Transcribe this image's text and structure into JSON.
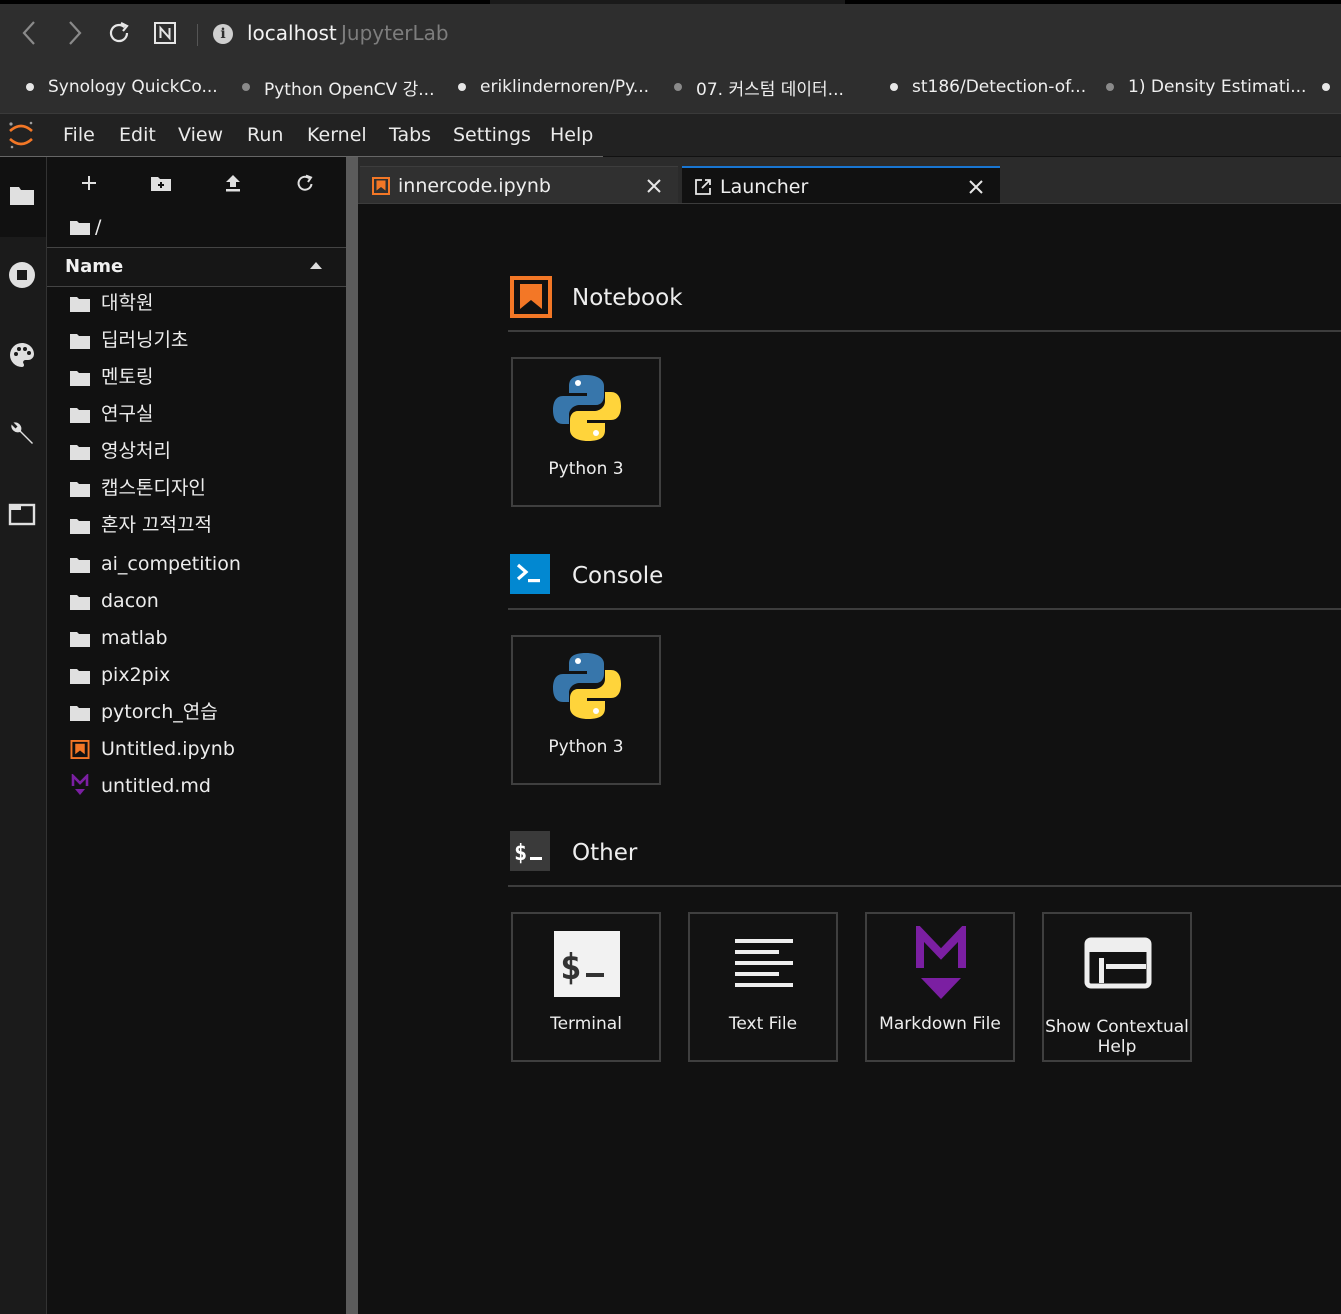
{
  "browser": {
    "url_host": "localhost",
    "page_title": "JupyterLab",
    "bookmarks": [
      {
        "label": "Synology QuickCo..."
      },
      {
        "label": "Python OpenCV 강..."
      },
      {
        "label": "eriklindernoren/Py..."
      },
      {
        "label": "07. 커스텀 데이터..."
      },
      {
        "label": "st186/Detection-of..."
      },
      {
        "label": "1) Density Estimati..."
      }
    ]
  },
  "menubar": {
    "items": [
      "File",
      "Edit",
      "View",
      "Run",
      "Kernel",
      "Tabs",
      "Settings",
      "Help"
    ]
  },
  "filebrowser": {
    "breadcrumb": "/",
    "column_header": "Name",
    "items": [
      {
        "name": "대학원",
        "type": "folder"
      },
      {
        "name": "딥러닝기초",
        "type": "folder"
      },
      {
        "name": "멘토링",
        "type": "folder"
      },
      {
        "name": "연구실",
        "type": "folder"
      },
      {
        "name": "영상처리",
        "type": "folder"
      },
      {
        "name": "캡스톤디자인",
        "type": "folder"
      },
      {
        "name": "혼자 끄적끄적",
        "type": "folder"
      },
      {
        "name": "ai_competition",
        "type": "folder"
      },
      {
        "name": "dacon",
        "type": "folder"
      },
      {
        "name": "matlab",
        "type": "folder"
      },
      {
        "name": "pix2pix",
        "type": "folder"
      },
      {
        "name": "pytorch_연습",
        "type": "folder"
      },
      {
        "name": "Untitled.ipynb",
        "type": "notebook"
      },
      {
        "name": "untitled.md",
        "type": "markdown"
      }
    ]
  },
  "tabs": [
    {
      "label": "innercode.ipynb",
      "icon": "notebook-icon"
    },
    {
      "label": "Launcher",
      "icon": "launcher-icon"
    }
  ],
  "launcher": {
    "sections": [
      {
        "title": "Notebook",
        "icon": "notebook-section-icon",
        "cards": [
          {
            "label": "Python 3",
            "icon": "python-logo-icon"
          }
        ]
      },
      {
        "title": "Console",
        "icon": "console-section-icon",
        "cards": [
          {
            "label": "Python 3",
            "icon": "python-logo-icon"
          }
        ]
      },
      {
        "title": "Other",
        "icon": "terminal-section-icon",
        "cards": [
          {
            "label": "Terminal",
            "icon": "terminal-icon"
          },
          {
            "label": "Text File",
            "icon": "text-file-icon"
          },
          {
            "label": "Markdown File",
            "icon": "markdown-icon"
          },
          {
            "label": "Show Contextual Help",
            "icon": "contextual-help-icon"
          }
        ]
      }
    ]
  },
  "colors": {
    "jupyter_orange": "#f37726",
    "console_blue": "#0288d1",
    "markdown_purple": "#7b1fa2",
    "active_tab_accent": "#1976d2"
  }
}
